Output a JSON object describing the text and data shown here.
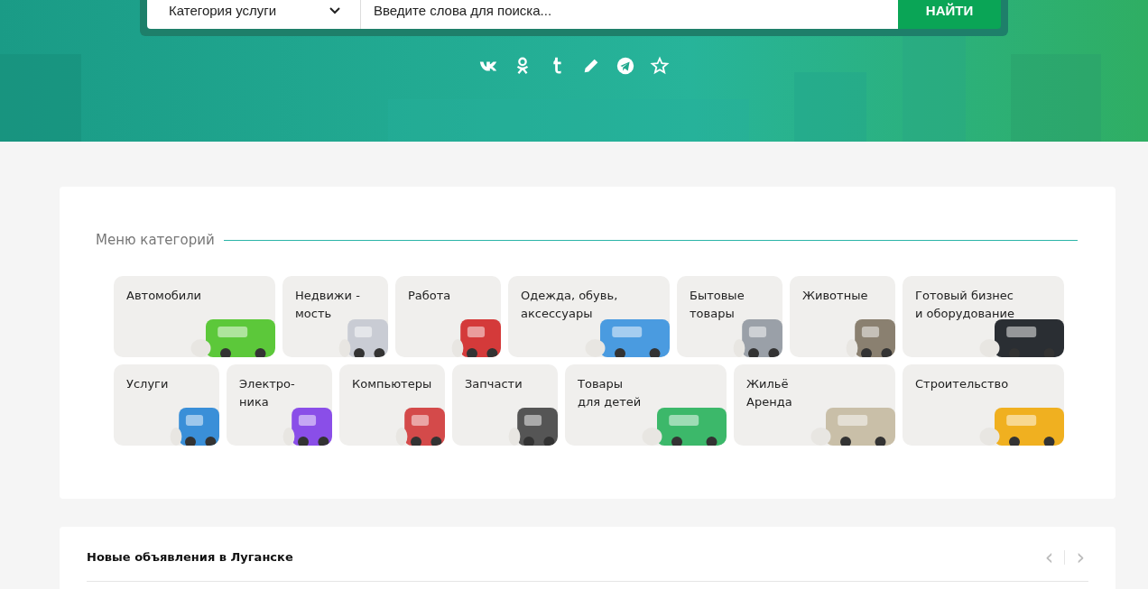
{
  "search": {
    "category": "Категория услуги",
    "placeholder": "Введите слова для поиска...",
    "button": "НАЙТИ"
  },
  "social": [
    {
      "kind": "vk"
    },
    {
      "kind": "ok"
    },
    {
      "kind": "tumblr"
    },
    {
      "kind": "pencil"
    },
    {
      "kind": "telegram"
    },
    {
      "kind": "star"
    }
  ],
  "categories_title": "Меню категорий",
  "category_rows": [
    [
      {
        "kind": "wide",
        "lines": [
          "Автомобили"
        ]
      },
      {
        "kind": "narrow",
        "lines": [
          "Недвижи -",
          " мость"
        ]
      },
      {
        "kind": "narrow",
        "lines": [
          "Работа"
        ]
      },
      {
        "kind": "wide",
        "lines": [
          "Одежда, обувь,",
          "аксессуары"
        ]
      },
      {
        "kind": "narrow",
        "lines": [
          "Бытовые",
          "товары"
        ]
      },
      {
        "kind": "narrow",
        "lines": [
          "Животные"
        ]
      },
      {
        "kind": "wide",
        "lines": [
          "Готовый бизнес",
          "и оборудование"
        ]
      }
    ],
    [
      {
        "kind": "narrow",
        "lines": [
          "Услуги"
        ]
      },
      {
        "kind": "narrow",
        "lines": [
          "Электро-",
          "ника"
        ]
      },
      {
        "kind": "narrow",
        "lines": [
          "Компьютеры"
        ]
      },
      {
        "kind": "narrow",
        "lines": [
          "Запчасти"
        ]
      },
      {
        "kind": "wide",
        "lines": [
          "Товары",
          "для детей"
        ]
      },
      {
        "kind": "wide",
        "lines": [
          "Жильё",
          "Аренда"
        ]
      },
      {
        "kind": "wide",
        "lines": [
          "Строительство"
        ]
      }
    ]
  ],
  "new_ads": {
    "title": "Новые объявления в Луганске",
    "prev": "‹",
    "next": "›"
  }
}
